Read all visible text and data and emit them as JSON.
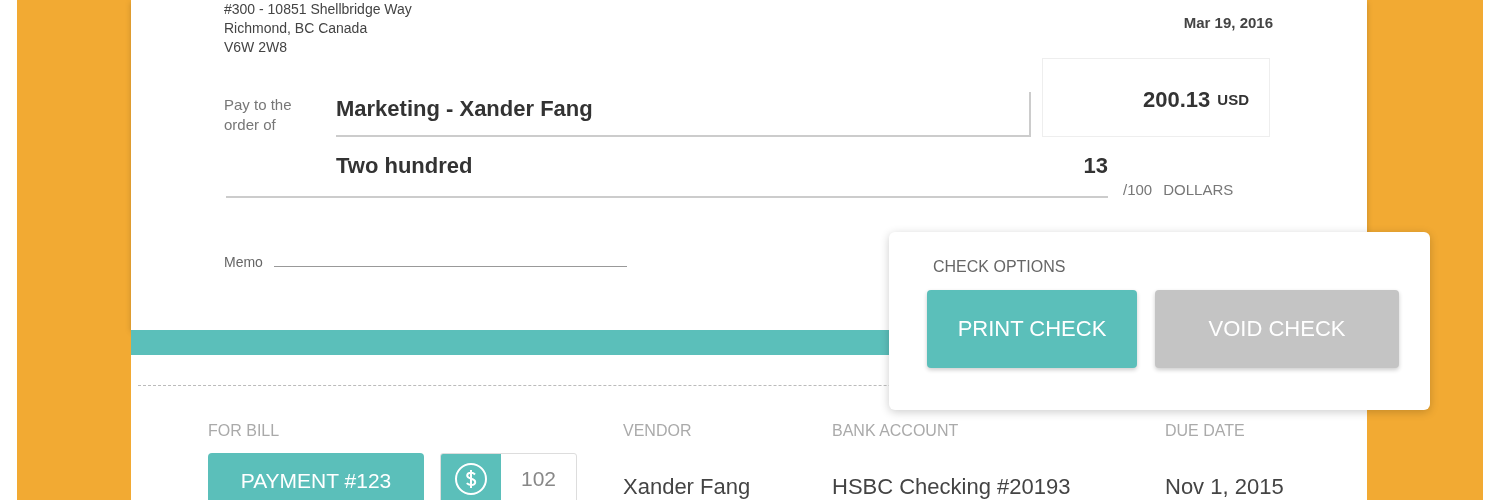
{
  "check": {
    "address_lines": [
      "#300 - 10851 Shellbridge Way",
      "Richmond, BC Canada",
      "V6W 2W8"
    ],
    "date": "Mar 19, 2016",
    "payee_label": "Pay to the order of",
    "payee": "Marketing - Xander Fang",
    "amount": "200.13",
    "currency": "USD",
    "amount_words": "Two hundred",
    "cents": "13",
    "cents_suffix": "/100",
    "unit": "DOLLARS",
    "memo_label": "Memo"
  },
  "check_options": {
    "title": "CHECK OPTIONS",
    "buttons": [
      {
        "label": "PRINT CHECK",
        "disabled": false
      },
      {
        "label": "VOID CHECK",
        "disabled": true
      }
    ]
  },
  "bill": {
    "for_bill": {
      "label": "FOR BILL",
      "payment": "PAYMENT #123",
      "check_number": "102"
    },
    "columns": [
      {
        "label": "VENDOR",
        "value": "Xander Fang"
      },
      {
        "label": "BANK ACCOUNT",
        "value": "HSBC Checking #20193"
      },
      {
        "label": "DUE DATE",
        "value": "Nov 1, 2015"
      }
    ]
  }
}
